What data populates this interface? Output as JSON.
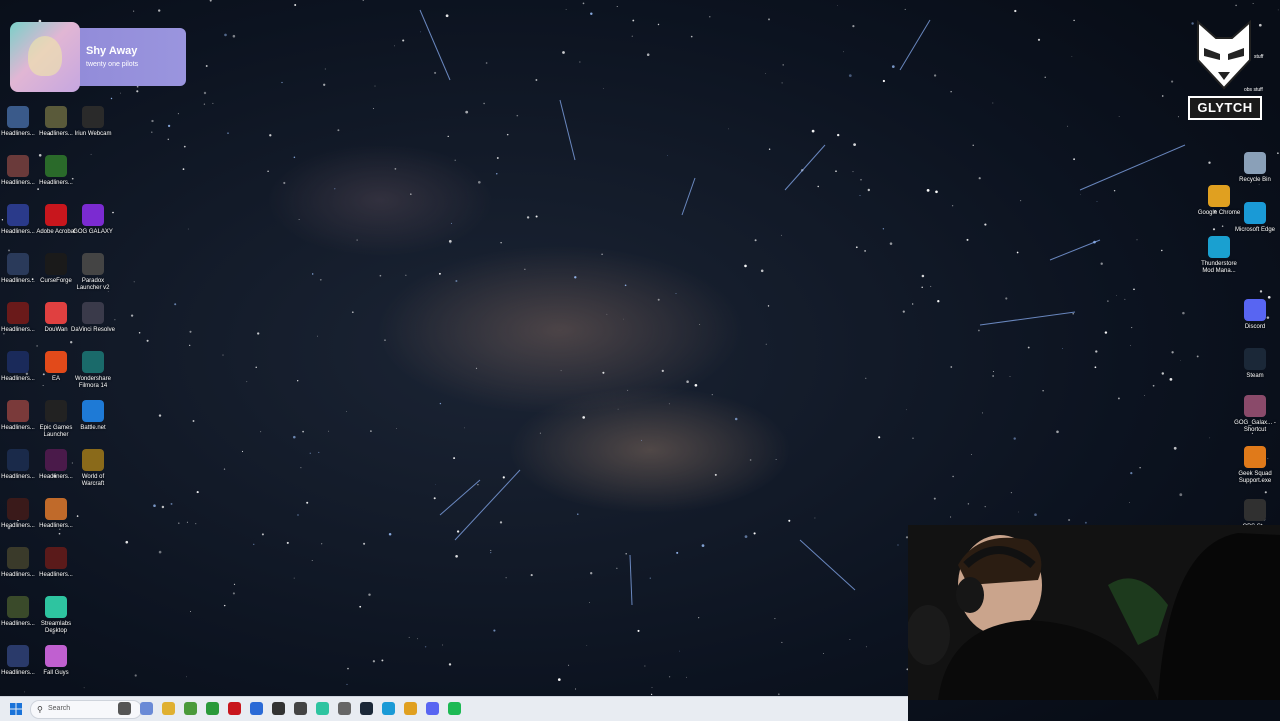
{
  "media_player": {
    "song_title": "Shy Away",
    "artist": "twenty one pilots"
  },
  "stream_logo": {
    "word": "GLYTCH"
  },
  "overlay_labels": {
    "obs_stuff_a": "stuff",
    "obs_stuff_b": "obs stuff"
  },
  "desktop_left": [
    {
      "label": "Headliners...",
      "color": "#3a5a8a"
    },
    {
      "label": "Headliners...",
      "color": "#5a5a3a"
    },
    {
      "label": "Iriun Webcam",
      "color": "#2a2a2a"
    },
    {
      "label": "Headliners...",
      "color": "#6a3a3a"
    },
    {
      "label": "Headliners...",
      "color": "#2a6a2a"
    },
    {
      "label": "Headliners...",
      "color": "#2a3a8a"
    },
    {
      "label": "Adobe Acrobat",
      "color": "#c8161d"
    },
    {
      "label": "GOG GALAXY",
      "color": "#7b2bd1"
    },
    {
      "label": "Headliners...",
      "color": "#2a3a5a"
    },
    {
      "label": "CurseForge",
      "color": "#1a1a1a"
    },
    {
      "label": "Paradox Launcher v2",
      "color": "#444444"
    },
    {
      "label": "Headliners...",
      "color": "#6a1a1a"
    },
    {
      "label": "DouWan",
      "color": "#e04040"
    },
    {
      "label": "DaVinci Resolve",
      "color": "#3a3a4a"
    },
    {
      "label": "Headliners...",
      "color": "#1a2a5a"
    },
    {
      "label": "EA",
      "color": "#e24a1a"
    },
    {
      "label": "Wondershare Filmora 14",
      "color": "#1a6a6a"
    },
    {
      "label": "Headliners...",
      "color": "#7a3a3a"
    },
    {
      "label": "Epic Games Launcher",
      "color": "#222222"
    },
    {
      "label": "Battle.net",
      "color": "#1e7ad6"
    },
    {
      "label": "Headliners...",
      "color": "#1a2a4a"
    },
    {
      "label": "Headliners...",
      "color": "#4a1a4a"
    },
    {
      "label": "World of Warcraft",
      "color": "#8a6a1a"
    },
    {
      "label": "Headliners...",
      "color": "#3a1a1a"
    },
    {
      "label": "Headliners...",
      "color": "#c06a2a"
    },
    {
      "label": "Headliners...",
      "color": "#3a3a2a"
    },
    {
      "label": "Headliners...",
      "color": "#5a1a1a"
    },
    {
      "label": "Headliners...",
      "color": "#3a4a2a"
    },
    {
      "label": "Streamlabs Desktop",
      "color": "#2ec4a0"
    },
    {
      "label": "Headliners...",
      "color": "#2a3a6a"
    },
    {
      "label": "Fall Guys",
      "color": "#c060d0"
    }
  ],
  "desktop_right": [
    {
      "label": "Recycle Bin",
      "color": "#8aa0b8"
    },
    {
      "label": "Google Chrome",
      "color": "#e0a020"
    },
    {
      "label": "Microsoft Edge",
      "color": "#1a9ad6"
    },
    {
      "label": "Thunderstore Mod Mana...",
      "color": "#1aa0d0"
    },
    {
      "label": "Discord",
      "color": "#5865f2"
    },
    {
      "label": "Steam",
      "color": "#1b2838"
    },
    {
      "label": "GOG_Galax... - Shortcut",
      "color": "#8a4a6a"
    },
    {
      "label": "Geek Squad Support.exe",
      "color": "#e07a1a"
    },
    {
      "label": "OBS St...",
      "color": "#303030"
    }
  ],
  "taskbar": {
    "search_placeholder": "Search",
    "apps": [
      {
        "name": "pen-tool-icon",
        "color": "#555555"
      },
      {
        "name": "copilot-icon",
        "color": "#6a8ad6"
      },
      {
        "name": "file-explorer-icon",
        "color": "#e0b030"
      },
      {
        "name": "minecraft-icon",
        "color": "#4a9a3a"
      },
      {
        "name": "xbox-icon",
        "color": "#2a9a3a"
      },
      {
        "name": "adobe-icon",
        "color": "#c8161d"
      },
      {
        "name": "store-icon",
        "color": "#2a6ad6"
      },
      {
        "name": "app-dark-icon",
        "color": "#333333"
      },
      {
        "name": "epic-icon",
        "color": "#444444"
      },
      {
        "name": "streamlabs-icon",
        "color": "#2ec4a0"
      },
      {
        "name": "paradox-icon",
        "color": "#666666"
      },
      {
        "name": "steam-icon",
        "color": "#1b2838"
      },
      {
        "name": "edge-icon",
        "color": "#1a9ad6"
      },
      {
        "name": "chrome-icon",
        "color": "#e0a020"
      },
      {
        "name": "discord-icon",
        "color": "#5865f2"
      },
      {
        "name": "spotify-icon",
        "color": "#1db954"
      }
    ]
  }
}
